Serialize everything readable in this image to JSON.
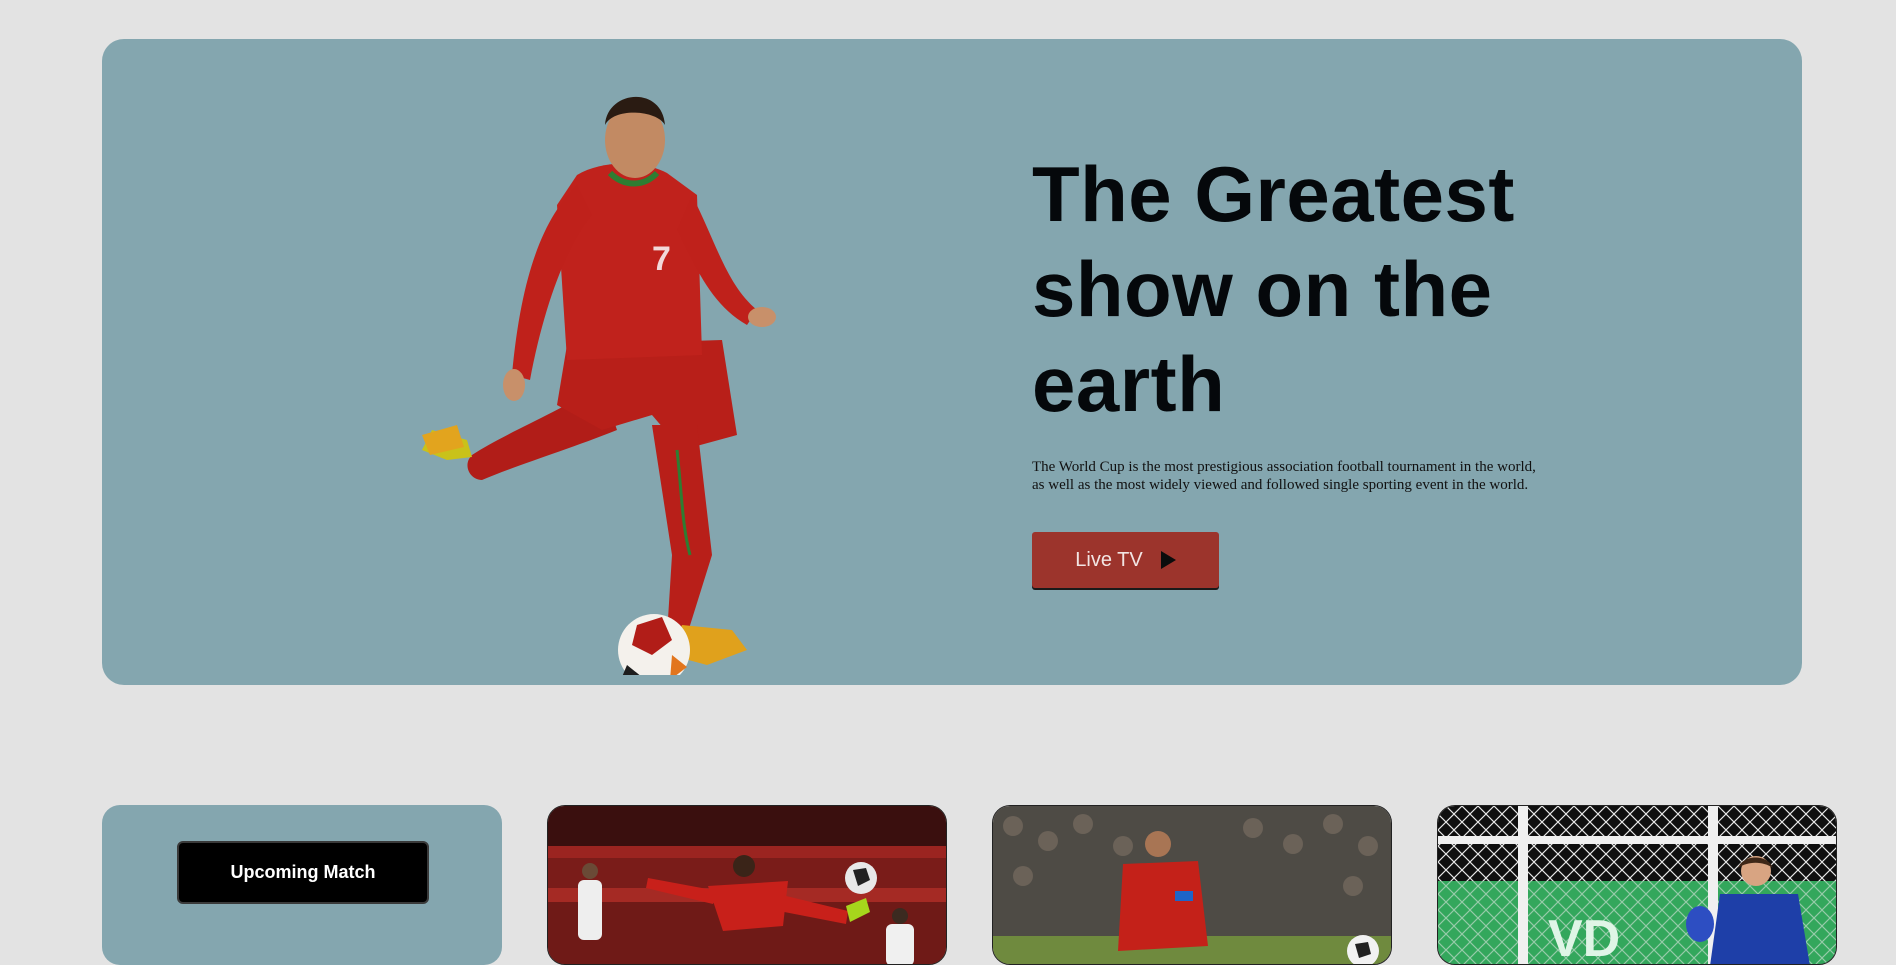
{
  "hero": {
    "title": "The Greatest show on the earth",
    "description": "The World Cup is the most prestigious association football tournament in the world, as well as the most widely viewed and followed single sporting event in the world.",
    "cta_label": "Live TV",
    "cta_icon": "play-icon",
    "jersey_number": "7"
  },
  "cards": {
    "upcoming_label": "Upcoming Match",
    "photo3_sign": "VD"
  },
  "colors": {
    "page_bg": "#e3e3e3",
    "hero_bg": "#84a6af",
    "cta_bg": "#9c342c",
    "jersey_red": "#c0221c"
  }
}
